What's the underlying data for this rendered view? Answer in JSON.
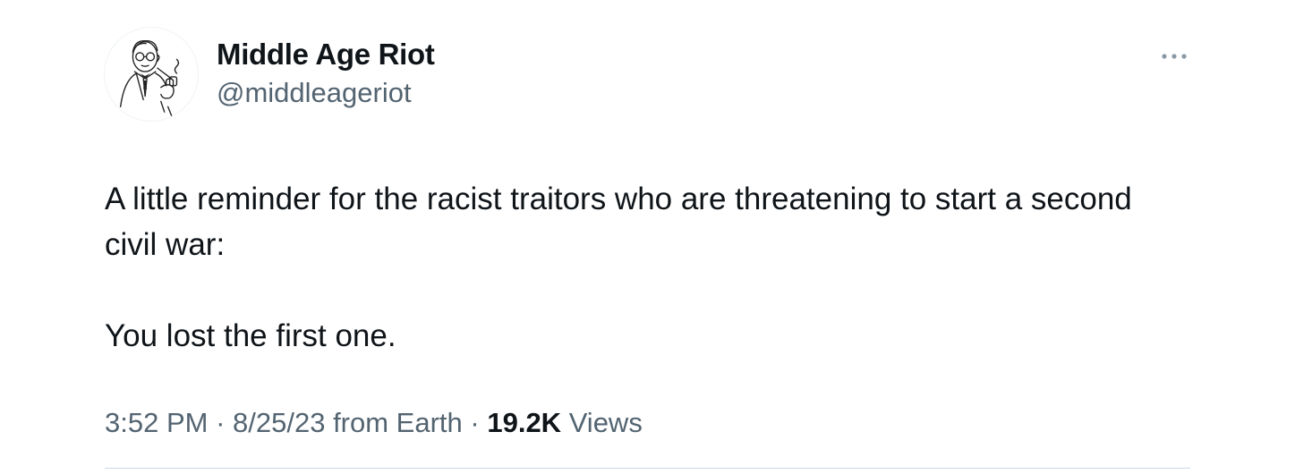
{
  "author": {
    "display_name": "Middle Age Riot",
    "handle": "@middleageriot",
    "avatar_icon": "retro-man-with-pipe-illustration"
  },
  "more_icon": "more-horizontal-icon",
  "tweet": {
    "paragraphs": [
      "A little reminder for the racist traitors who are threatening to start a second civil war:",
      "You lost the first one."
    ]
  },
  "meta": {
    "time": "3:52 PM",
    "sep1": " · ",
    "date": "8/25/23",
    "source": " from Earth",
    "sep2": " · ",
    "views_count": "19.2K",
    "views_label": " Views"
  },
  "colors": {
    "text_primary": "#0f1419",
    "text_secondary": "#536471",
    "divider": "#cfd9de"
  }
}
